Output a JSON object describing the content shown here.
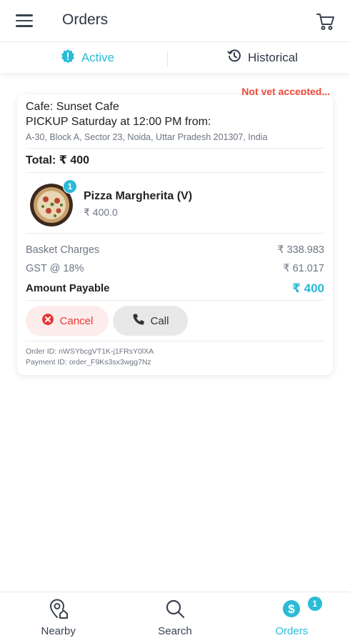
{
  "header": {
    "title": "Orders"
  },
  "tabs": {
    "active": "Active",
    "historical": "Historical"
  },
  "order": {
    "status": "Not yet accepted...",
    "cafe": "Cafe: Sunset Cafe",
    "pickup": "PICKUP Saturday at 12:00 PM from:",
    "address": "A-30, Block A, Sector 23, Noida, Uttar Pradesh 201307, India",
    "total": "Total: ₹ 400",
    "item": {
      "name": "Pizza Margherita (V)",
      "price": "₹ 400.0",
      "quantity": "1"
    },
    "basket_label": "Basket Charges",
    "basket_value": "₹ 338.983",
    "gst_label": "GST @ 18%",
    "gst_value": "₹ 61.017",
    "payable_label": "Amount Payable",
    "payable_value": "₹ 400",
    "cancel_label": "Cancel",
    "call_label": "Call",
    "order_id": "Order ID: nWSYbcgVT1K-j1FRsY0lXA",
    "payment_id": "Payment ID: order_F9Ks3sx3wgg7Nz"
  },
  "nav": {
    "nearby": "Nearby",
    "search": "Search",
    "orders": "Orders",
    "orders_badge": "1"
  },
  "colors": {
    "accent": "#2bbbd6",
    "danger": "#f04a3a"
  }
}
